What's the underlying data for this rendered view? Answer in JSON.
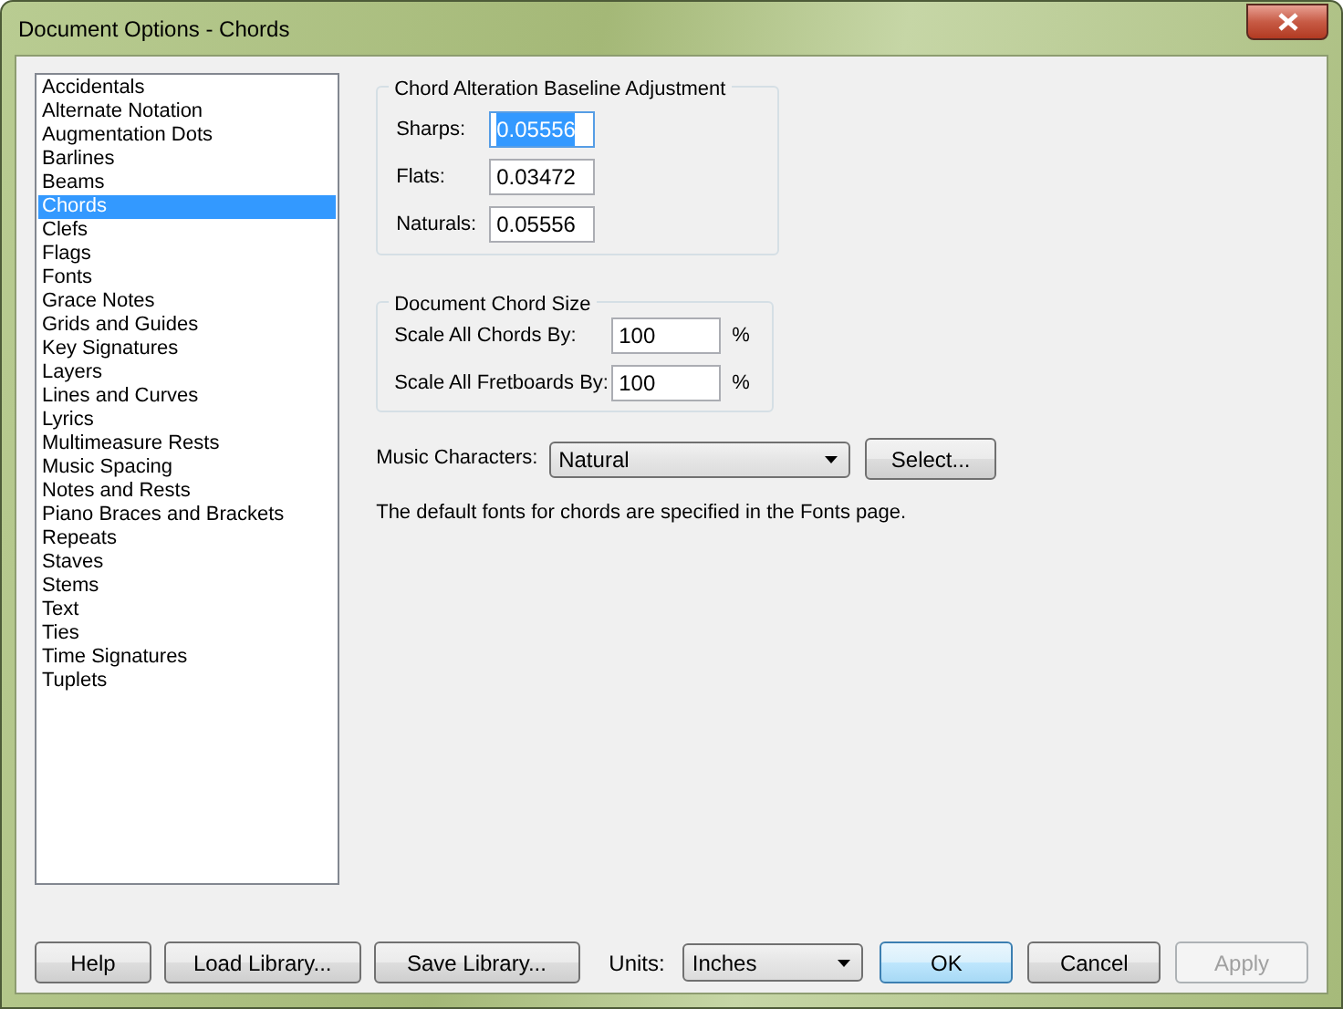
{
  "window": {
    "title": "Document Options - Chords"
  },
  "categories": [
    {
      "label": "Accidentals",
      "selected": false
    },
    {
      "label": "Alternate Notation",
      "selected": false
    },
    {
      "label": "Augmentation Dots",
      "selected": false
    },
    {
      "label": "Barlines",
      "selected": false
    },
    {
      "label": "Beams",
      "selected": false
    },
    {
      "label": "Chords",
      "selected": true
    },
    {
      "label": "Clefs",
      "selected": false
    },
    {
      "label": "Flags",
      "selected": false
    },
    {
      "label": "Fonts",
      "selected": false
    },
    {
      "label": "Grace Notes",
      "selected": false
    },
    {
      "label": "Grids and Guides",
      "selected": false
    },
    {
      "label": "Key Signatures",
      "selected": false
    },
    {
      "label": "Layers",
      "selected": false
    },
    {
      "label": "Lines and Curves",
      "selected": false
    },
    {
      "label": "Lyrics",
      "selected": false
    },
    {
      "label": "Multimeasure Rests",
      "selected": false
    },
    {
      "label": "Music Spacing",
      "selected": false
    },
    {
      "label": "Notes and Rests",
      "selected": false
    },
    {
      "label": "Piano Braces and Brackets",
      "selected": false
    },
    {
      "label": "Repeats",
      "selected": false
    },
    {
      "label": "Staves",
      "selected": false
    },
    {
      "label": "Stems",
      "selected": false
    },
    {
      "label": "Text",
      "selected": false
    },
    {
      "label": "Ties",
      "selected": false
    },
    {
      "label": "Time Signatures",
      "selected": false
    },
    {
      "label": "Tuplets",
      "selected": false
    }
  ],
  "baseline_group": {
    "title": "Chord Alteration Baseline Adjustment",
    "fields": [
      {
        "label": "Sharps:",
        "value": "0.05556",
        "text_selected": true
      },
      {
        "label": "Flats:",
        "value": "0.03472",
        "text_selected": false
      },
      {
        "label": "Naturals:",
        "value": "0.05556",
        "text_selected": false
      }
    ]
  },
  "size_group": {
    "title": "Document Chord Size",
    "fields": [
      {
        "label": "Scale All Chords By:",
        "value": "100",
        "unit": "%"
      },
      {
        "label": "Scale All Fretboards By:",
        "value": "100",
        "unit": "%"
      }
    ]
  },
  "music_characters": {
    "label": "Music Characters:",
    "value": "Natural",
    "button": "Select..."
  },
  "note": "The default fonts for chords are specified in the Fonts page.",
  "footer": {
    "left_buttons": [
      {
        "label": "Help",
        "disabled": false
      },
      {
        "label": "Load Library...",
        "disabled": false
      },
      {
        "label": "Save Library...",
        "disabled": false
      }
    ],
    "units_label": "Units:",
    "units_value": "Inches",
    "right_buttons": [
      {
        "label": "OK",
        "default": true,
        "disabled": false
      },
      {
        "label": "Cancel",
        "default": false,
        "disabled": false
      },
      {
        "label": "Apply",
        "default": false,
        "disabled": true
      }
    ]
  }
}
